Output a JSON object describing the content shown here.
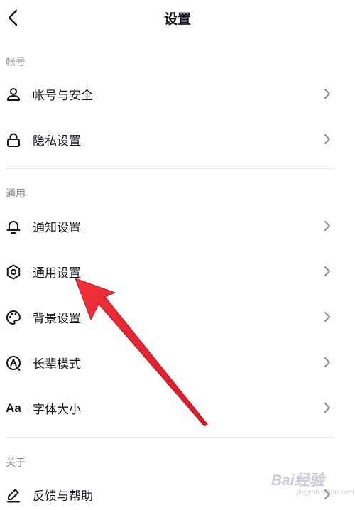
{
  "header": {
    "title": "设置",
    "back_icon": "chevron-left-icon"
  },
  "sections": {
    "account": {
      "title": "帐号",
      "items": [
        {
          "label": "帐号与安全",
          "icon": "user-icon"
        },
        {
          "label": "隐私设置",
          "icon": "lock-icon"
        }
      ]
    },
    "general": {
      "title": "通用",
      "items": [
        {
          "label": "通知设置",
          "icon": "bell-icon"
        },
        {
          "label": "通用设置",
          "icon": "gear-icon"
        },
        {
          "label": "背景设置",
          "icon": "palette-icon"
        },
        {
          "label": "长辈模式",
          "icon": "elder-mode-icon"
        },
        {
          "label": "字体大小",
          "icon": "font-size-icon",
          "icon_text": "Aa"
        }
      ]
    },
    "about": {
      "title": "关于",
      "items": [
        {
          "label": "反馈与帮助",
          "icon": "edit-icon"
        }
      ]
    }
  },
  "watermark": {
    "brand": "Bai经验",
    "sub": "jingyan.baidu.com"
  },
  "colors": {
    "text": "#161823",
    "secondary": "#8a8b91",
    "divider": "#e8e8ea",
    "arrow": "#e8242e"
  }
}
